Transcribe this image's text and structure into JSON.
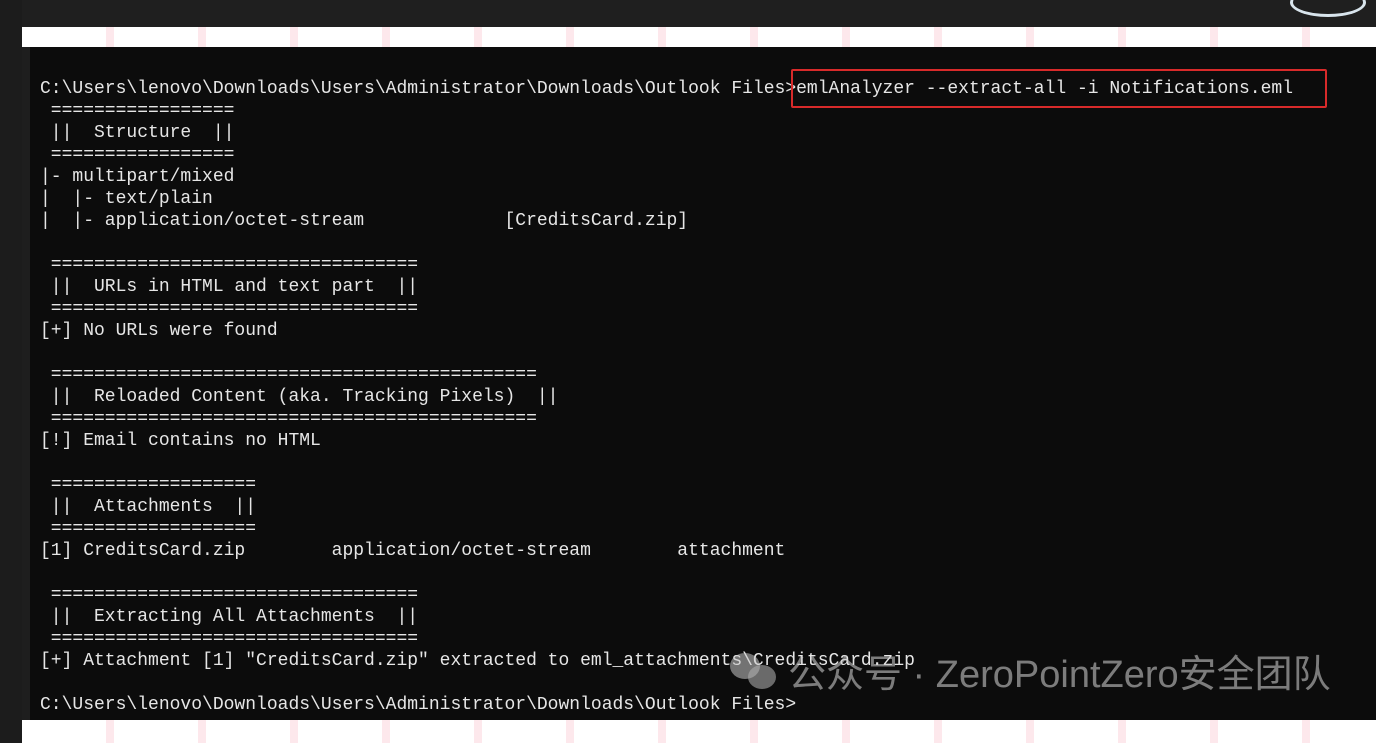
{
  "terminal": {
    "lines": [
      "C:\\Users\\lenovo\\Downloads\\Users\\Administrator\\Downloads\\Outlook Files>emlAnalyzer --extract-all -i Notifications.eml",
      " =================",
      " ||  Structure  ||",
      " =================",
      "|- multipart/mixed",
      "|  |- text/plain",
      "|  |- application/octet-stream             [CreditsCard.zip]",
      "",
      " ==================================",
      " ||  URLs in HTML and text part  ||",
      " ==================================",
      "[+] No URLs were found",
      "",
      " =============================================",
      " ||  Reloaded Content (aka. Tracking Pixels)  ||",
      " =============================================",
      "[!] Email contains no HTML",
      "",
      " ===================",
      " ||  Attachments  ||",
      " ===================",
      "[1] CreditsCard.zip        application/octet-stream        attachment",
      "",
      " ==================================",
      " ||  Extracting All Attachments  ||",
      " ==================================",
      "[+] Attachment [1] \"CreditsCard.zip\" extracted to eml_attachments\\CreditsCard.zip",
      "",
      "C:\\Users\\lenovo\\Downloads\\Users\\Administrator\\Downloads\\Outlook Files>"
    ],
    "highlighted_command": "emlAnalyzer --extract-all -i Notifications.eml",
    "highlight_color": "#d82a2a"
  },
  "watermark": {
    "icon": "wechat-icon",
    "text": "公众号 · ZeroPointZero安全团队"
  }
}
